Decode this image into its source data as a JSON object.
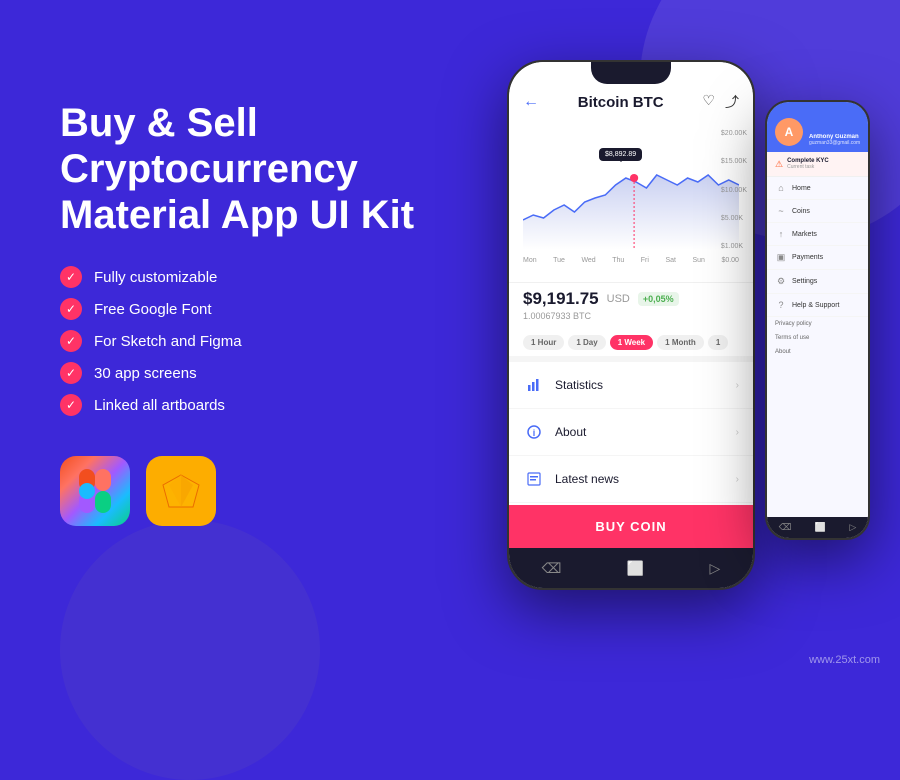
{
  "background": "#3d28d8",
  "left": {
    "title": "Buy & Sell\nCryptocurrency\nMaterial App UI Kit",
    "features": [
      "Fully customizable",
      "Free Google Font",
      "For Sketch and Figma",
      "30 app screens",
      "Linked all artboards"
    ],
    "icons": [
      {
        "name": "Figma",
        "symbol": "✦"
      },
      {
        "name": "Sketch",
        "symbol": "◇"
      }
    ]
  },
  "phone_main": {
    "header": {
      "title": "Bitcoin BTC",
      "back_icon": "←",
      "heart_icon": "♡",
      "share_icon": "⤴"
    },
    "chart": {
      "y_labels": [
        "$20.00K",
        "$15.00K",
        "$10.00K",
        "$5.00K",
        "$1.00K",
        "$0.00"
      ],
      "x_labels": [
        "Mon",
        "Tue",
        "Wed",
        "Thu",
        "Fri",
        "Sat",
        "Sun"
      ],
      "tooltip": "$8,892.89"
    },
    "price": {
      "value": "$9,191.75",
      "currency": "USD",
      "change": "+0,05%",
      "btc": "1.00067933 BTC"
    },
    "time_filters": [
      "1 Hour",
      "1 Day",
      "1 Week",
      "1 Month",
      "1"
    ],
    "active_filter": "1 Week",
    "menu_items": [
      {
        "icon": "📊",
        "label": "Statistics"
      },
      {
        "icon": "ℹ",
        "label": "About"
      },
      {
        "icon": "📰",
        "label": "Latest news"
      }
    ],
    "buy_btn": "BUY COIN"
  },
  "phone_side": {
    "user": {
      "name": "Anthony Guzman",
      "email": "guzman33@gmail.com"
    },
    "kyc": {
      "title": "Complete KYC",
      "subtitle": "Current task"
    },
    "menu": [
      {
        "icon": "⌂",
        "label": "Home"
      },
      {
        "icon": "◎",
        "label": "Coins"
      },
      {
        "icon": "↑",
        "label": "Markets"
      },
      {
        "icon": "▣",
        "label": "Payments"
      },
      {
        "icon": "⚙",
        "label": "Settings"
      },
      {
        "icon": "?",
        "label": "Help & Support"
      }
    ],
    "links": [
      "Privacy policy",
      "Terms of use",
      "About"
    ]
  },
  "watermark": "www.25xt.com"
}
